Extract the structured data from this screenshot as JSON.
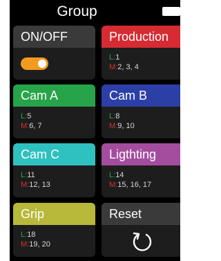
{
  "header": {
    "title": "Group",
    "battery_icon": "battery-icon"
  },
  "colors": {
    "onoff": "#3a3a3a",
    "production": "#d72b33",
    "cam_a": "#27a34a",
    "cam_b": "#2b3fa6",
    "cam_c": "#2fc0c0",
    "lighting": "#a44d9f",
    "grip": "#b8b83a",
    "reset": "#3a3a3a",
    "toggle_on": "#f39a1f",
    "l_label": "#2aa74a",
    "m_label": "#d23232"
  },
  "tiles": {
    "onoff": {
      "title": "ON/OFF",
      "toggle_state": "on"
    },
    "production": {
      "title": "Production",
      "l": "1",
      "m": "2, 3, 4"
    },
    "cam_a": {
      "title": "Cam A",
      "l": "5",
      "m": "6, 7"
    },
    "cam_b": {
      "title": "Cam B",
      "l": "8",
      "m": "9, 10"
    },
    "cam_c": {
      "title": "Cam C",
      "l": "11",
      "m": "12, 13"
    },
    "lighting": {
      "title": "Ligthting",
      "l": "14",
      "m": "15, 16, 17"
    },
    "grip": {
      "title": "Grip",
      "l": "18",
      "m": "19, 20"
    },
    "reset": {
      "title": "Reset",
      "icon": "reset-icon"
    }
  },
  "labels": {
    "l": "L:",
    "m": "M:"
  }
}
